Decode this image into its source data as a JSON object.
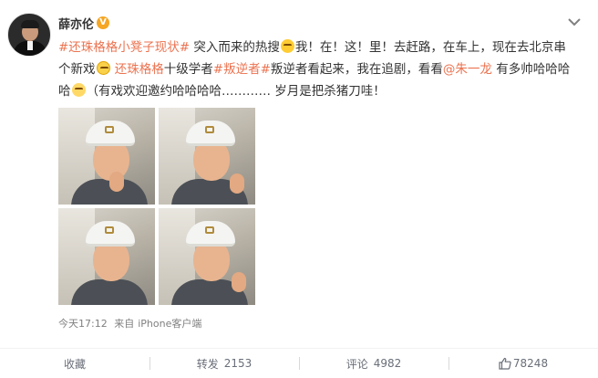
{
  "post": {
    "username": "薛亦伦",
    "verified_badge": "V",
    "text": {
      "topic_1": "#还珠格格小凳子现状#",
      "seg_1": " 突入而来的热搜",
      "seg_2": "我！在！这！里！去赶路，在车上，现在去北京串个新戏",
      "topic_2": "还珠格格",
      "seg_3": "十级学者",
      "topic_3": "#叛逆者#",
      "seg_4": "叛逆者看起来，我在追剧，看看",
      "mention": "@朱一龙",
      "seg_5": " 有多帅哈哈哈哈",
      "seg_6": "（有戏欢迎邀约哈哈哈哈………… 岁月是把杀猪刀哇！"
    },
    "photos": [
      "photo-1",
      "photo-2",
      "photo-3",
      "photo-4"
    ],
    "timestamp": "今天17:12",
    "source_prefix": "来自",
    "source": "iPhone客户端"
  },
  "actions": {
    "favorite_label": "收藏",
    "repost_label": "转发",
    "repost_count": "2153",
    "comment_label": "评论",
    "comment_count": "4982",
    "like_count": "78248"
  },
  "icons": {
    "verified": "verified-badge-icon",
    "more": "chevron-down-icon",
    "like": "thumbs-up-icon"
  },
  "colors": {
    "link": "#eb7350",
    "verified": "#f5a623",
    "meta": "#808080"
  }
}
